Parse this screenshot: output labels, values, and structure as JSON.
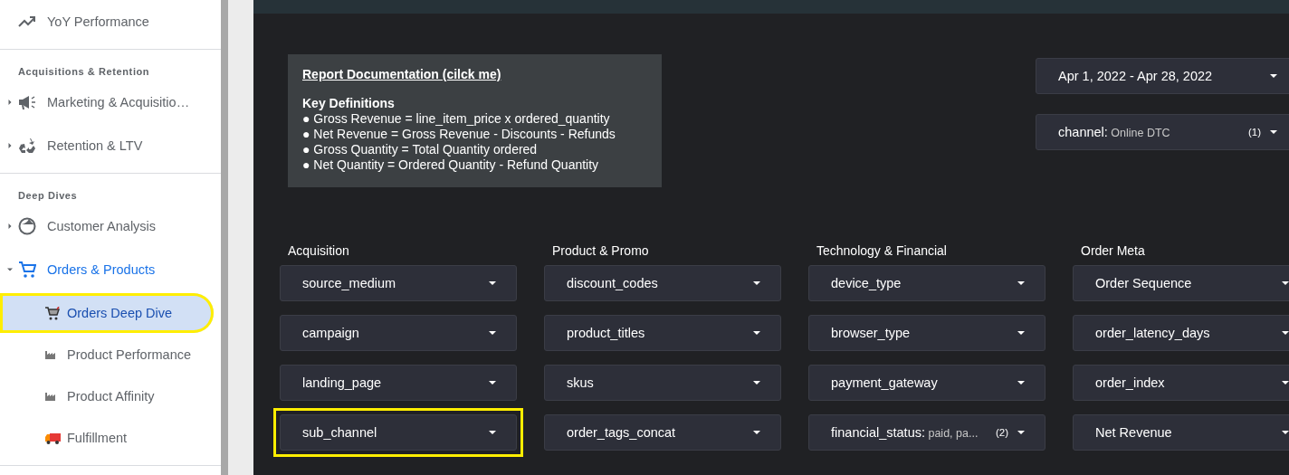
{
  "sidebar": {
    "groups": [
      {
        "items": [
          {
            "label": "YoY Performance",
            "active": false
          }
        ]
      },
      {
        "title": "Acquisitions & Retention",
        "items": [
          {
            "label": "Marketing & Acquisitio…",
            "active": false,
            "expanded": false
          },
          {
            "label": "Retention & LTV",
            "active": false,
            "expanded": false
          }
        ]
      },
      {
        "title": "Deep Dives",
        "items": [
          {
            "label": "Customer Analysis",
            "active": false,
            "expanded": false
          },
          {
            "label": "Orders & Products",
            "active": true,
            "expanded": true,
            "children": [
              {
                "label": "Orders Deep Dive",
                "selected": true,
                "highlighted": true
              },
              {
                "label": "Product Performance",
                "selected": false,
                "highlighted": false
              },
              {
                "label": "Product Affinity",
                "selected": false,
                "highlighted": false
              },
              {
                "label": "Fulfillment",
                "selected": false,
                "highlighted": false
              }
            ]
          }
        ]
      }
    ]
  },
  "documentation": {
    "link": "Report Documentation (cilck me)",
    "heading": "Key Definitions",
    "bullets": [
      "● Gross Revenue = line_item_price x ordered_quantity",
      "● Net Revenue = Gross Revenue - Discounts - Refunds",
      "● Gross Quantity = Total Quantity ordered",
      "● Net Quantity = Ordered Quantity - Refund Quantity"
    ]
  },
  "date_range": {
    "value": "Apr 1, 2022 - Apr 28, 2022"
  },
  "channel_filter": {
    "label": "channel:",
    "value": "Online DTC",
    "count": "(1)"
  },
  "filter_groups": [
    {
      "title": "Acquisition",
      "filters": [
        {
          "label": "source_medium",
          "highlighted": false
        },
        {
          "label": "campaign",
          "highlighted": false
        },
        {
          "label": "landing_page",
          "highlighted": false
        },
        {
          "label": "sub_channel",
          "highlighted": true
        }
      ]
    },
    {
      "title": "Product & Promo",
      "filters": [
        {
          "label": "discount_codes",
          "highlighted": false
        },
        {
          "label": "product_titles",
          "highlighted": false
        },
        {
          "label": "skus",
          "highlighted": false
        },
        {
          "label": "order_tags_concat",
          "highlighted": false
        }
      ]
    },
    {
      "title": "Technology & Financial",
      "filters": [
        {
          "label": "device_type",
          "highlighted": false
        },
        {
          "label": "browser_type",
          "highlighted": false
        },
        {
          "label": "payment_gateway",
          "highlighted": false
        },
        {
          "label": "financial_status:",
          "value": "paid, pa...",
          "count": "(2)",
          "highlighted": false
        }
      ]
    },
    {
      "title": "Order Meta",
      "filters": [
        {
          "label": "Order Sequence",
          "highlighted": false
        },
        {
          "label": "order_latency_days",
          "highlighted": false
        },
        {
          "label": "order_index",
          "highlighted": false
        },
        {
          "label": "Net Revenue",
          "highlighted": false
        }
      ]
    }
  ]
}
